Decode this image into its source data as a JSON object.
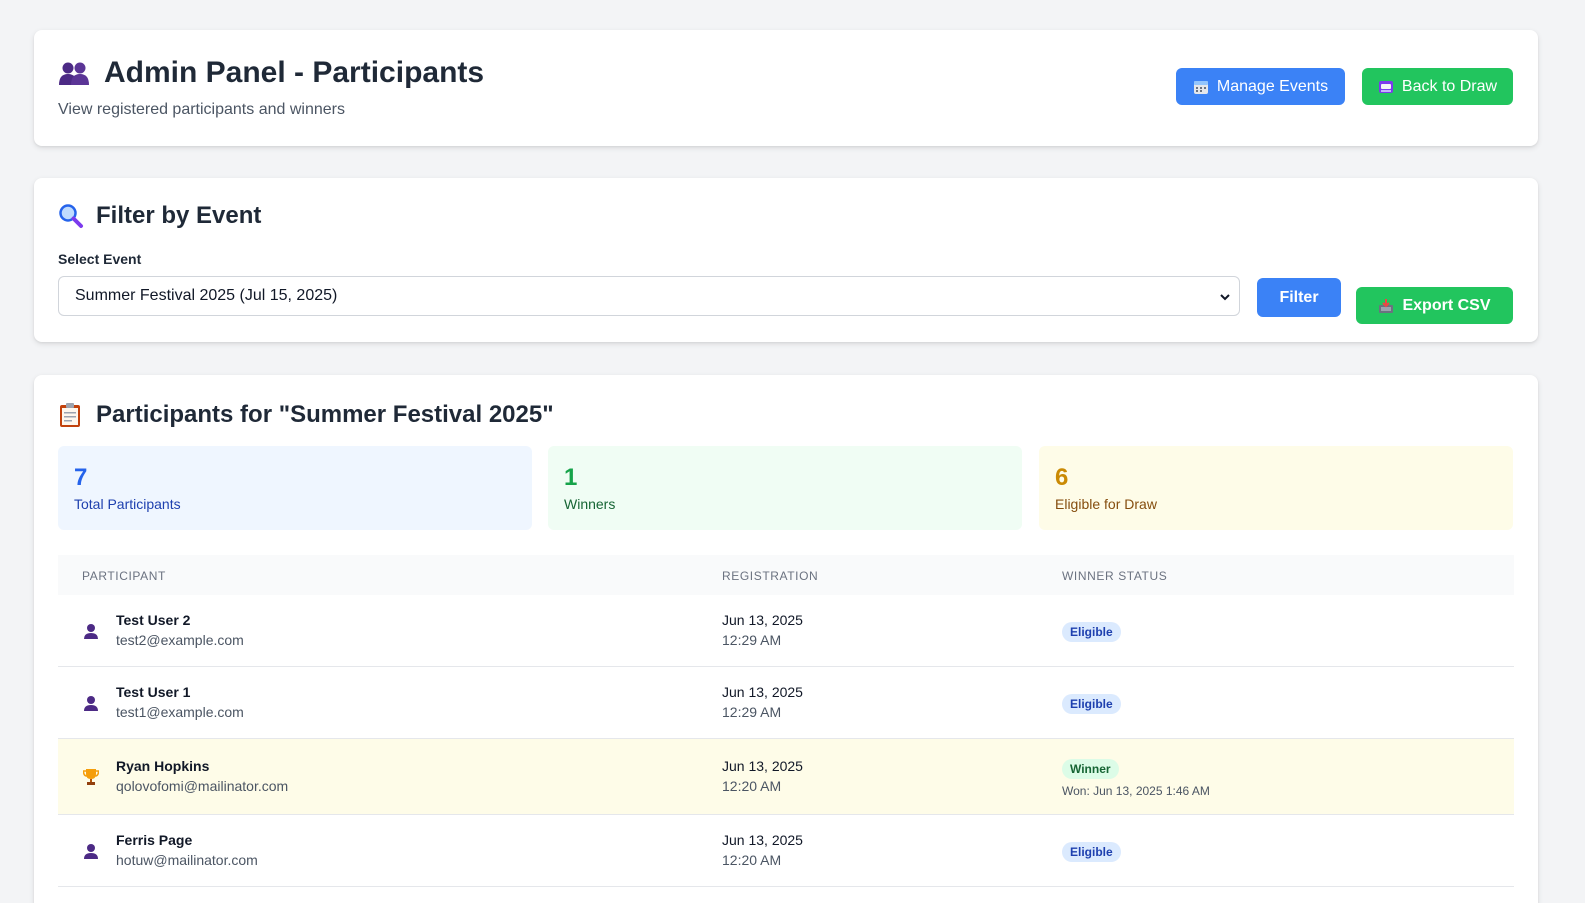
{
  "header": {
    "title": "Admin Panel - Participants",
    "title_icon": "people-icon",
    "subtitle": "View registered participants and winners",
    "manage_events_label": "Manage Events",
    "back_to_draw_label": "Back to Draw"
  },
  "filter": {
    "title": "Filter by Event",
    "title_icon": "magnifier-icon",
    "select_label": "Select Event",
    "selected_event": "Summer Festival 2025 (Jul 15, 2025)",
    "filter_button": "Filter",
    "export_button": "Export CSV"
  },
  "participants": {
    "title": "Participants for \"Summer Festival 2025\"",
    "title_icon": "clipboard-icon",
    "stats": {
      "total": {
        "value": "7",
        "label": "Total Participants"
      },
      "winners": {
        "value": "1",
        "label": "Winners"
      },
      "eligible": {
        "value": "6",
        "label": "Eligible for Draw"
      }
    },
    "columns": [
      "Participant",
      "Registration",
      "Winner Status"
    ],
    "rows": [
      {
        "name": "Test User 2",
        "email": "test2@example.com",
        "date": "Jun 13, 2025",
        "time": "12:29 AM",
        "status": "Eligible",
        "icon": "user-icon"
      },
      {
        "name": "Test User 1",
        "email": "test1@example.com",
        "date": "Jun 13, 2025",
        "time": "12:29 AM",
        "status": "Eligible",
        "icon": "user-icon"
      },
      {
        "name": "Ryan Hopkins",
        "email": "qolovofomi@mailinator.com",
        "date": "Jun 13, 2025",
        "time": "12:20 AM",
        "status": "Winner",
        "won": "Won: Jun 13, 2025 1:46 AM",
        "icon": "trophy-icon"
      },
      {
        "name": "Ferris Page",
        "email": "hotuw@mailinator.com",
        "date": "Jun 13, 2025",
        "time": "12:20 AM",
        "status": "Eligible",
        "icon": "user-icon"
      }
    ]
  },
  "colors": {
    "primary_blue": "#3b82f6",
    "success_green": "#22c55e",
    "winner_row": "#fefce8"
  }
}
